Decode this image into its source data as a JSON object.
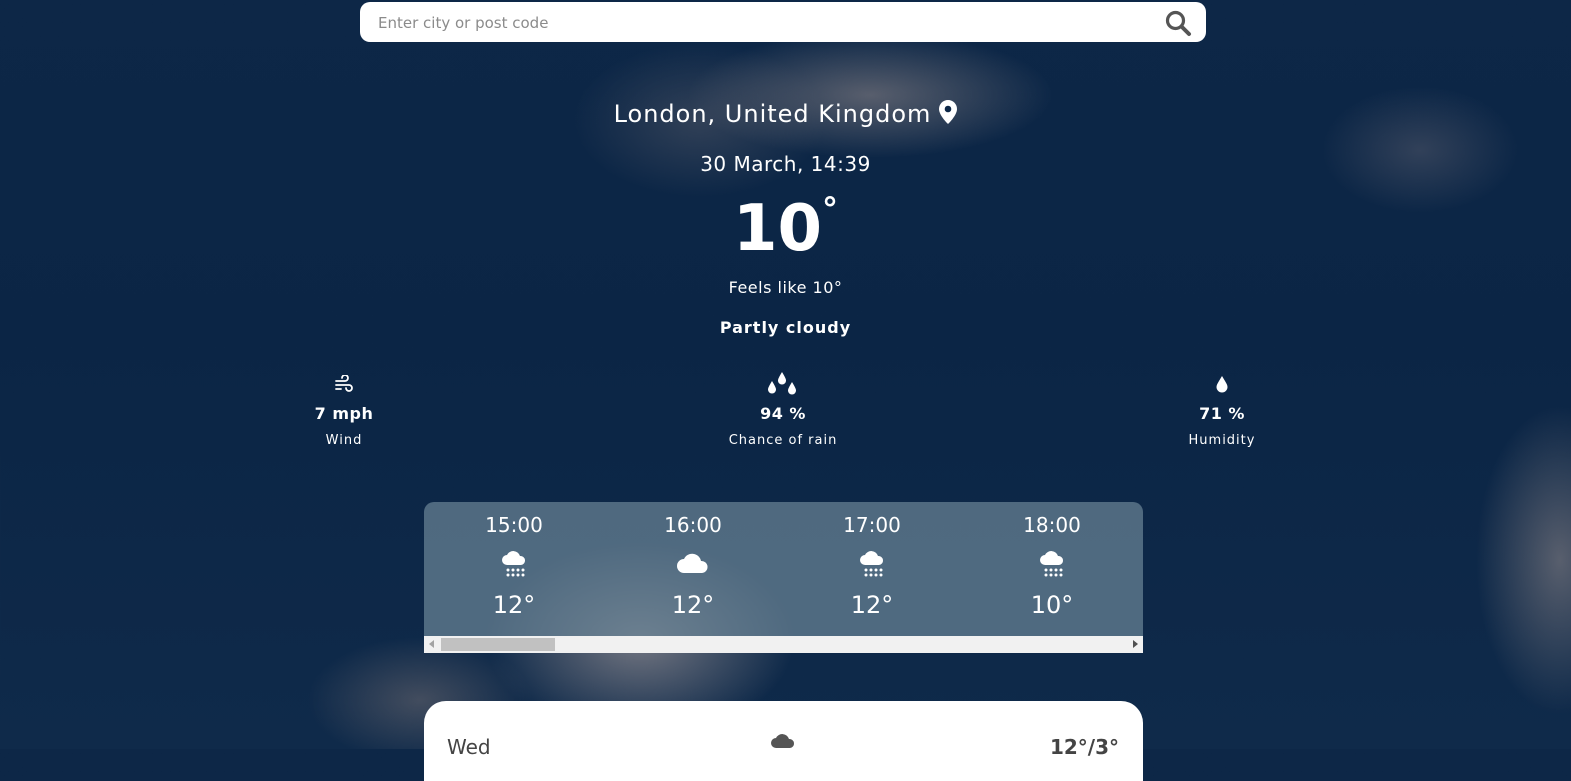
{
  "search": {
    "placeholder": "Enter city or post code",
    "icon": "search-icon"
  },
  "location": "London, United Kingdom",
  "datetime": "30 March, 14:39",
  "current": {
    "temperature": "10",
    "degree_symbol": "°",
    "feels_like": "Feels like 10°",
    "condition": "Partly cloudy"
  },
  "metrics": [
    {
      "value": "7 mph",
      "label": "Wind",
      "icon": "wind-icon"
    },
    {
      "value": "94 %",
      "label": "Chance of rain",
      "icon": "raindrops-icon"
    },
    {
      "value": "71 %",
      "label": "Humidity",
      "icon": "droplet-icon"
    }
  ],
  "hourly": [
    {
      "time": "15:00",
      "temp": "12°",
      "icon": "rain-cloud-icon"
    },
    {
      "time": "16:00",
      "temp": "12°",
      "icon": "cloud-icon"
    },
    {
      "time": "17:00",
      "temp": "12°",
      "icon": "rain-cloud-icon"
    },
    {
      "time": "18:00",
      "temp": "10°",
      "icon": "rain-cloud-icon"
    }
  ],
  "daily": [
    {
      "day": "Wed",
      "range": "12°/3°",
      "icon": "cloud-icon"
    }
  ],
  "colors": {
    "background": "#0b2545",
    "hourly_panel": "#6a8496",
    "daily_panel": "#ffffff"
  }
}
